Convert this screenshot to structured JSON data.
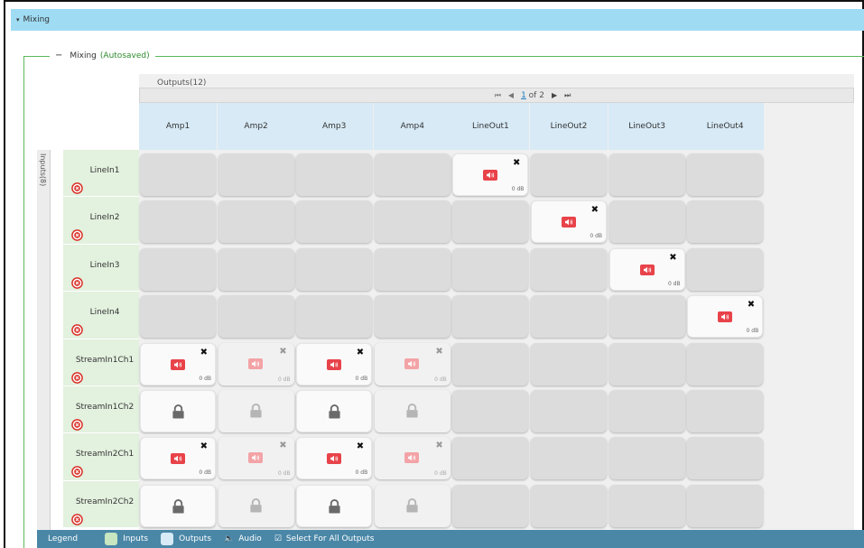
{
  "header": {
    "caret": "▾",
    "title": "Mixing"
  },
  "section": {
    "dash": "−",
    "title": "Mixing",
    "autosaved": "(Autosaved)"
  },
  "outputs": {
    "caption": "Outputs(12)",
    "pager": {
      "first": "⏮",
      "prev": "◀",
      "current": "1",
      "of": "of 2",
      "next": "▶",
      "last": "⏭"
    },
    "columns": [
      "Amp1",
      "Amp2",
      "Amp3",
      "Amp4",
      "LineOut1",
      "LineOut2",
      "LineOut3",
      "LineOut4"
    ]
  },
  "inputs": {
    "label": "Inputs(8)",
    "rows": [
      "LineIn1",
      "LineIn2",
      "LineIn3",
      "LineIn4",
      "StreamIn1Ch1",
      "StreamIn1Ch2",
      "StreamIn2Ch1",
      "StreamIn2Ch2"
    ]
  },
  "matrix": [
    [
      "empty",
      "empty",
      "empty",
      "empty",
      "active",
      "empty",
      "empty",
      "empty"
    ],
    [
      "empty",
      "empty",
      "empty",
      "empty",
      "empty",
      "active",
      "empty",
      "empty"
    ],
    [
      "empty",
      "empty",
      "empty",
      "empty",
      "empty",
      "empty",
      "active",
      "empty"
    ],
    [
      "empty",
      "empty",
      "empty",
      "empty",
      "empty",
      "empty",
      "empty",
      "active"
    ],
    [
      "active",
      "faded",
      "active",
      "faded",
      "empty",
      "empty",
      "empty",
      "empty"
    ],
    [
      "lock",
      "lock-faded",
      "lock",
      "lock-faded",
      "empty",
      "empty",
      "empty",
      "empty"
    ],
    [
      "active",
      "faded",
      "active",
      "faded",
      "empty",
      "empty",
      "empty",
      "empty"
    ],
    [
      "lock",
      "lock-faded",
      "lock",
      "lock-faded",
      "empty",
      "empty",
      "empty",
      "empty"
    ]
  ],
  "cell_text": {
    "gain": "0 dB",
    "remove": "✖"
  },
  "legend": {
    "title": "Legend",
    "inputs": "Inputs",
    "outputs": "Outputs",
    "audio": "Audio",
    "select_all": "Select For All Outputs"
  },
  "colors": {
    "header_bar": "#9fdcf3",
    "column_header": "#d7eaf6",
    "row_header": "#e3f1df",
    "audio_active": "#e8434a",
    "legend_bar": "#4a87a7",
    "autosaved": "#2e8b2e"
  },
  "icons": [
    "remove-circle-icon",
    "audio-icon",
    "lock-icon",
    "close-x-icon",
    "checkbox-icon"
  ]
}
